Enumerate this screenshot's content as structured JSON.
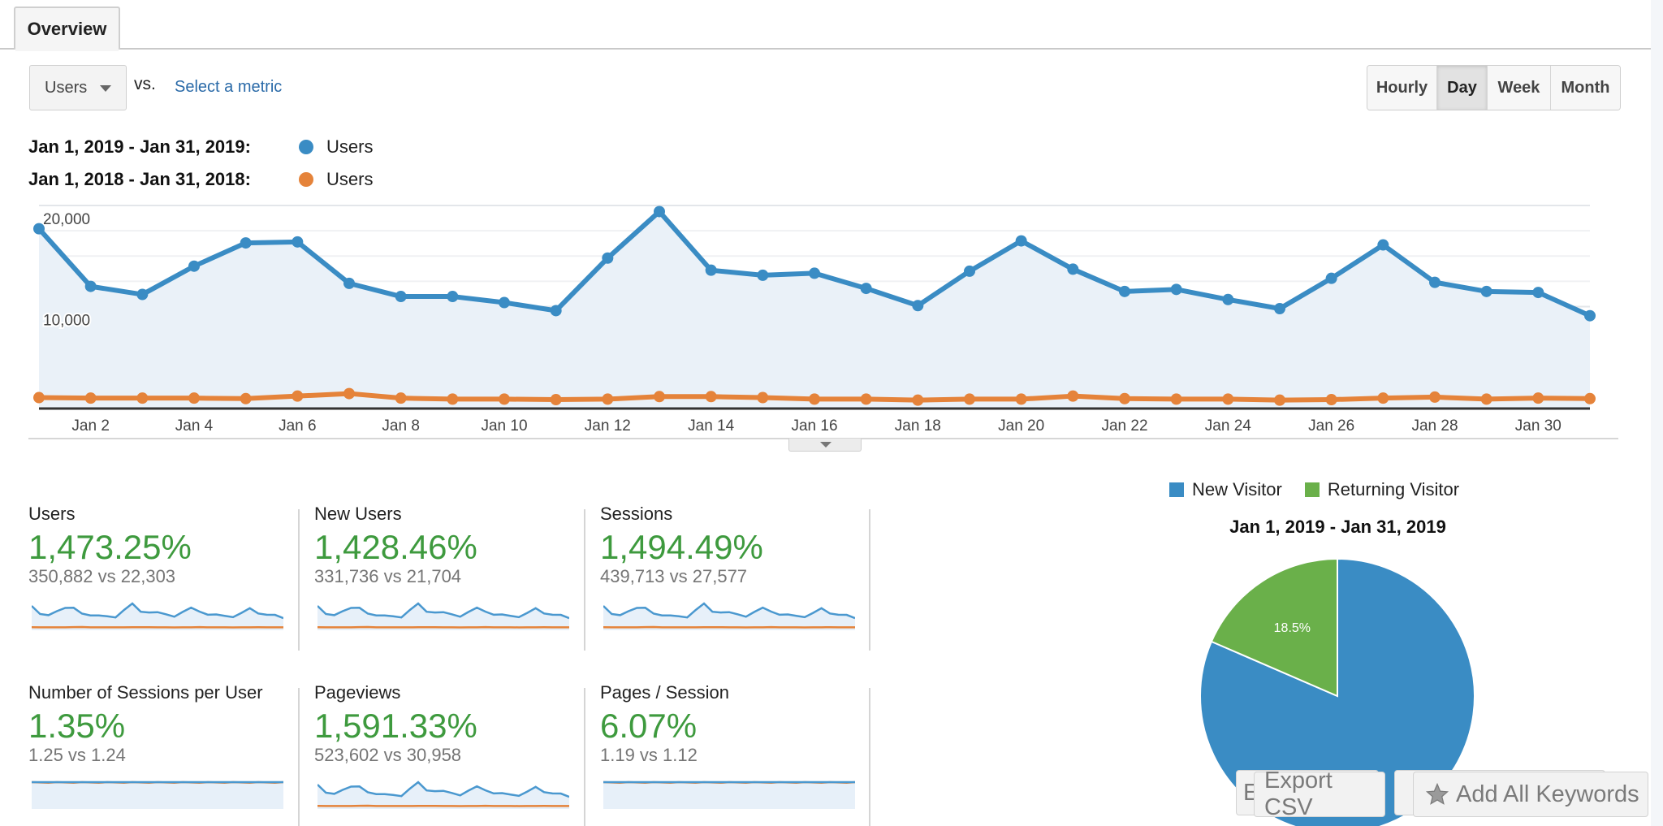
{
  "tabs": [
    {
      "label": "Overview",
      "active": true
    }
  ],
  "metric_selector": {
    "selected": "Users",
    "vs_label": "vs.",
    "select_metric_link": "Select a metric"
  },
  "period_buttons": [
    {
      "label": "Hourly",
      "active": false
    },
    {
      "label": "Day",
      "active": true
    },
    {
      "label": "Week",
      "active": false
    },
    {
      "label": "Month",
      "active": false
    }
  ],
  "legend": [
    {
      "date_range": "Jan 1, 2019 - Jan 31, 2019:",
      "metric": "Users",
      "color": "#3a8cc4"
    },
    {
      "date_range": "Jan 1, 2018 - Jan 31, 2018:",
      "metric": "Users",
      "color": "#e5833a"
    }
  ],
  "chart_data": [
    {
      "type": "line",
      "title": "",
      "xlabel": "",
      "ylabel": "Users",
      "ylim": [
        0,
        20000
      ],
      "y_ticks": [
        "10,000",
        "20,000"
      ],
      "y_tick_values": [
        10000,
        20000
      ],
      "grid": true,
      "x": [
        "Jan 1",
        "Jan 2",
        "Jan 3",
        "Jan 4",
        "Jan 5",
        "Jan 6",
        "Jan 7",
        "Jan 8",
        "Jan 9",
        "Jan 10",
        "Jan 11",
        "Jan 12",
        "Jan 13",
        "Jan 14",
        "Jan 15",
        "Jan 16",
        "Jan 17",
        "Jan 18",
        "Jan 19",
        "Jan 20",
        "Jan 21",
        "Jan 22",
        "Jan 23",
        "Jan 24",
        "Jan 25",
        "Jan 26",
        "Jan 27",
        "Jan 28",
        "Jan 29",
        "Jan 30",
        "Jan 31"
      ],
      "x_tick_labels": [
        "Jan 2",
        "Jan 4",
        "Jan 6",
        "Jan 8",
        "Jan 10",
        "Jan 12",
        "Jan 14",
        "Jan 16",
        "Jan 18",
        "Jan 20",
        "Jan 22",
        "Jan 24",
        "Jan 26",
        "Jan 28",
        "Jan 30"
      ],
      "series": [
        {
          "name": "Users (Jan 1, 2019 - Jan 31, 2019)",
          "color": "#3a8cc4",
          "values": [
            17700,
            12000,
            11200,
            14000,
            16300,
            16400,
            12300,
            11000,
            11000,
            10400,
            9600,
            14800,
            19400,
            13600,
            13100,
            13300,
            11800,
            10100,
            13500,
            16500,
            13700,
            11500,
            11700,
            10700,
            9800,
            12800,
            16100,
            12400,
            11500,
            11400,
            9100
          ]
        },
        {
          "name": "Users (Jan 1, 2018 - Jan 31, 2018)",
          "color": "#e5833a",
          "values": [
            1000,
            950,
            950,
            950,
            900,
            1150,
            1400,
            950,
            850,
            850,
            800,
            850,
            1100,
            1100,
            1000,
            850,
            850,
            750,
            850,
            850,
            1150,
            900,
            850,
            850,
            750,
            800,
            950,
            1050,
            850,
            950,
            900
          ]
        }
      ]
    },
    {
      "type": "pie",
      "title": "Jan 1, 2019 - Jan 31, 2019",
      "legend": [
        "New Visitor",
        "Returning Visitor"
      ],
      "legend_position": "top",
      "slices": [
        {
          "label": "New Visitor",
          "value": 81.5,
          "color": "#3a8cc4"
        },
        {
          "label": "Returning Visitor",
          "value": 18.5,
          "color": "#6ab04a",
          "data_label": "18.5%"
        }
      ]
    }
  ],
  "metrics": [
    {
      "title": "Users",
      "change": "1,473.25%",
      "compare": "350,882 vs 22,303",
      "flat": false
    },
    {
      "title": "New Users",
      "change": "1,428.46%",
      "compare": "331,736 vs 21,704",
      "flat": false
    },
    {
      "title": "Sessions",
      "change": "1,494.49%",
      "compare": "439,713 vs 27,577",
      "flat": false
    },
    {
      "title": "Number of Sessions per User",
      "change": "1.35%",
      "compare": "1.25 vs 1.24",
      "flat": true
    },
    {
      "title": "Pageviews",
      "change": "1,591.33%",
      "compare": "523,602 vs 30,958",
      "flat": false
    },
    {
      "title": "Pages / Session",
      "change": "6.07%",
      "compare": "1.19 vs 1.12",
      "flat": true
    }
  ],
  "pie_section": {
    "legend": [
      {
        "label": "New Visitor",
        "color": "#3a8cc4"
      },
      {
        "label": "Returning Visitor",
        "color": "#6ab04a"
      }
    ],
    "date_range": "Jan 1, 2019 - Jan 31, 2019"
  },
  "bottom_buttons": {
    "export_csv": "Export CSV",
    "add_keywords": "Add All Keywords",
    "hidden_behind_label": "E"
  },
  "colors": {
    "positive_change": "#3e9a3e",
    "link": "#2a6aa8"
  }
}
